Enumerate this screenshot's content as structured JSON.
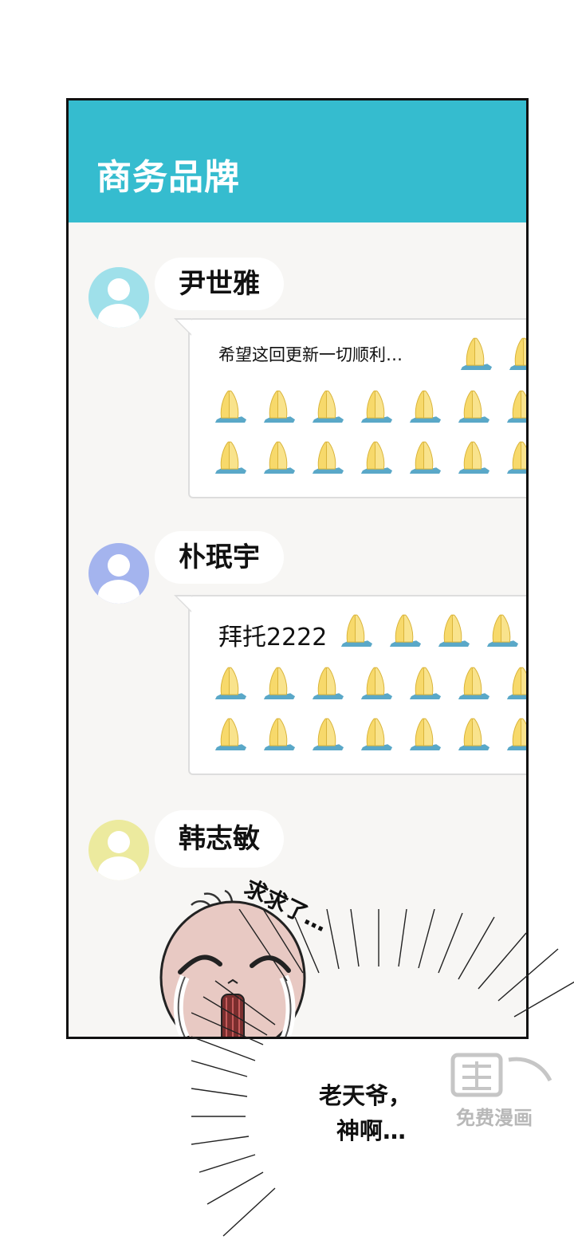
{
  "header": {
    "title": "商务品牌"
  },
  "messages": [
    {
      "sender": "尹世雅",
      "text": "希望这回更新一切顺利…",
      "avatar_color": "#9fe0ea"
    },
    {
      "sender": "朴珉宇",
      "text": "拜托2222",
      "avatar_color": "#a4b4ee"
    },
    {
      "sender": "韩志敏",
      "avatar_color": "#ecea9e"
    }
  ],
  "comic": {
    "cry_text": "求求了…",
    "shout_line1": "老天爷，",
    "shout_line2": "神啊…"
  },
  "watermark": {
    "text": "免费漫画"
  },
  "icons": [
    "folded-hands-emoji",
    "user-avatar-icon"
  ]
}
